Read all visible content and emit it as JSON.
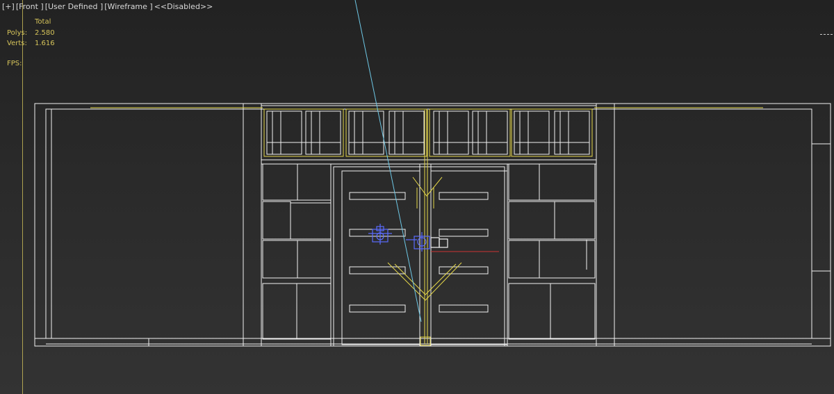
{
  "viewport": {
    "menu_plus": "[+]",
    "view_name": "[Front ]",
    "shading_preset": "[User Defined ]",
    "shading_mode": "[Wireframe ]",
    "disabled": "<<Disabled>>"
  },
  "stats": {
    "header": "Total",
    "polys_label": "Polys:",
    "polys_value": "2.580",
    "verts_label": "Verts:",
    "verts_value": "1.616",
    "fps_label": "FPS:"
  },
  "colors": {
    "wire_white": "#ffffff",
    "wire_yellow": "#e6d84a",
    "camera_blue": "#5a6cff",
    "guide_cyan": "#6ec8e6",
    "axis_red": "#cc3333",
    "stats_text": "#d6c45a"
  }
}
